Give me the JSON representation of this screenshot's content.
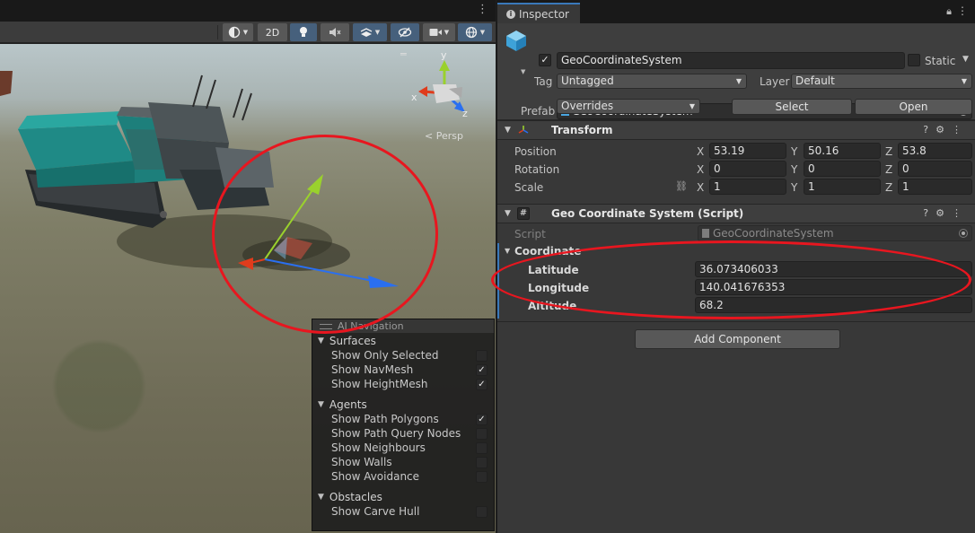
{
  "scene": {
    "more_icon": "⋮",
    "toolbar": {
      "twod_label": "2D",
      "icons": [
        "draw-mode-icon",
        "lighting-icon",
        "audio-icon",
        "effects-icon",
        "hidden-objects-icon",
        "camera-icon",
        "gizmos-icon"
      ]
    },
    "persp_label": "< Persp",
    "gizmo_axes": {
      "x": "x",
      "y": "y",
      "z": "z"
    }
  },
  "ai_navigation": {
    "title": "AI Navigation",
    "sections": [
      {
        "title": "Surfaces",
        "items": [
          {
            "label": "Show Only Selected",
            "checked": false
          },
          {
            "label": "Show NavMesh",
            "checked": true
          },
          {
            "label": "Show HeightMesh",
            "checked": true
          }
        ]
      },
      {
        "title": "Agents",
        "items": [
          {
            "label": "Show Path Polygons",
            "checked": true
          },
          {
            "label": "Show Path Query Nodes",
            "checked": false
          },
          {
            "label": "Show Neighbours",
            "checked": false
          },
          {
            "label": "Show Walls",
            "checked": false
          },
          {
            "label": "Show Avoidance",
            "checked": false
          }
        ]
      },
      {
        "title": "Obstacles",
        "items": [
          {
            "label": "Show Carve Hull",
            "checked": false
          }
        ]
      }
    ]
  },
  "inspector": {
    "tab_label": "Inspector",
    "object": {
      "name": "GeoCoordinateSystem",
      "active": true,
      "static_label": "Static",
      "tag_label": "Tag",
      "tag_value": "Untagged",
      "layer_label": "Layer",
      "layer_value": "Default",
      "prefab_label": "Prefab",
      "prefab_value": "GeoCoordinateSystem",
      "overrides_label": "Overrides",
      "select_label": "Select",
      "open_label": "Open"
    },
    "transform": {
      "title": "Transform",
      "position_label": "Position",
      "rotation_label": "Rotation",
      "scale_label": "Scale",
      "position": {
        "x": "53.19",
        "y": "50.16",
        "z": "53.8"
      },
      "rotation": {
        "x": "0",
        "y": "0",
        "z": "0"
      },
      "scale": {
        "x": "1",
        "y": "1",
        "z": "1"
      },
      "axis_x": "X",
      "axis_y": "Y",
      "axis_z": "Z"
    },
    "geo_script": {
      "title": "Geo Coordinate System (Script)",
      "script_label": "Script",
      "script_value": "GeoCoordinateSystem",
      "coordinate_label": "Coordinate",
      "latitude_label": "Latitude",
      "latitude_value": "36.073406033",
      "longitude_label": "Longitude",
      "longitude_value": "140.041676353",
      "altitude_label": "Altitude",
      "altitude_value": "68.2"
    },
    "add_component_label": "Add Component"
  },
  "colors": {
    "accent": "#3a79bb",
    "highlight_red": "#e8161f",
    "gizmo_x": "#e03c1c",
    "gizmo_y": "#9ad12d",
    "gizmo_z": "#2a6ff0",
    "vehicle_body": "#1f8a86"
  }
}
